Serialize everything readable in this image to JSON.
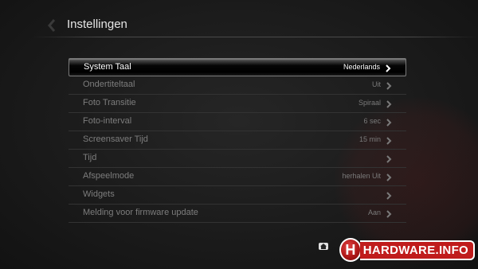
{
  "header": {
    "title": "Instellingen"
  },
  "settings": [
    {
      "label": "System Taal",
      "value": "Nederlands",
      "selected": true
    },
    {
      "label": "Ondertiteltaal",
      "value": "Uit"
    },
    {
      "label": "Foto Transitie",
      "value": "Spiraal"
    },
    {
      "label": "Foto-interval",
      "value": "6 sec"
    },
    {
      "label": "Screensaver Tijd",
      "value": "15 min"
    },
    {
      "label": "Tijd",
      "value": ""
    },
    {
      "label": "Afspeelmode",
      "value": "herhalen Uit"
    },
    {
      "label": "Widgets",
      "value": ""
    },
    {
      "label": "Melding voor firmware update",
      "value": "Aan"
    }
  ],
  "icons": {
    "back": "chevron-left-icon",
    "row": "chevron-right-icon",
    "footer": "home-icon"
  },
  "watermark": {
    "brand_letter": "H",
    "brand_text": "HARDWARE.INFO"
  },
  "colors": {
    "background": "#1c1c1c",
    "selected_row": "#000000",
    "brand_red": "#c01c1c"
  }
}
